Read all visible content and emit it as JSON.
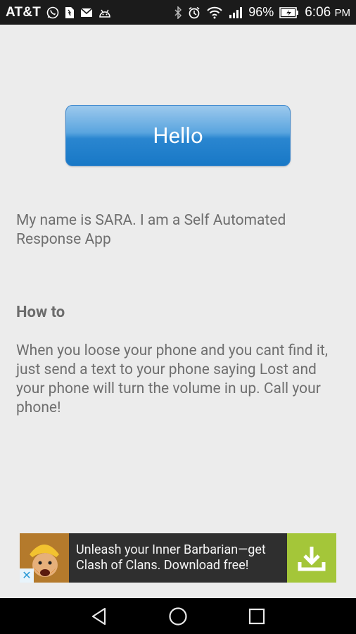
{
  "status_bar": {
    "carrier": "AT&T",
    "battery_percent": "96%",
    "time": "6:06",
    "ampm": "PM"
  },
  "main": {
    "hello_label": "Hello",
    "intro": "My name is SARA. I am a Self Automated Response App",
    "howto_title": "How to",
    "howto_body": "When you loose your phone and you cant find it, just send a text to your phone saying Lost and your phone will turn the volume in up. Call your phone!"
  },
  "ad": {
    "text": "Unleash your Inner Barbarian—get Clash of Clans. Download free!",
    "close_glyph": "✕"
  },
  "colors": {
    "button_blue": "#1878c6",
    "ad_cta_green": "#a4c639",
    "text_gray": "#6f6f6f"
  }
}
